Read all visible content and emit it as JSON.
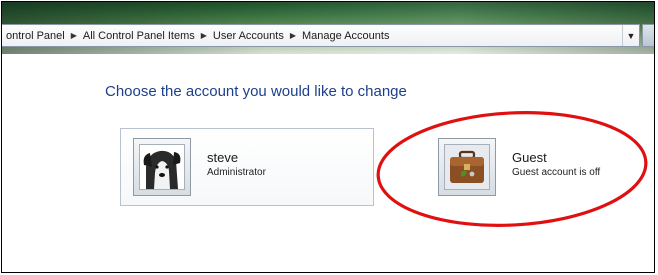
{
  "address_bar": {
    "breadcrumbs": [
      "ontrol Panel",
      "All Control Panel Items",
      "User Accounts",
      "Manage Accounts"
    ],
    "dropdown_icon": "chevron-down-icon"
  },
  "main": {
    "heading": "Choose the account you would like to change",
    "accounts": [
      {
        "name": "steve",
        "role": "Administrator",
        "avatar_icon": "dog-photo-icon"
      },
      {
        "name": "Guest",
        "role": "Guest account is off",
        "avatar_icon": "briefcase-icon"
      }
    ]
  },
  "annotation": {
    "color": "#e01010",
    "shape": "ellipse"
  },
  "colors": {
    "heading": "#1e3f8c",
    "address_bar_bg": "#f4f6f8"
  }
}
